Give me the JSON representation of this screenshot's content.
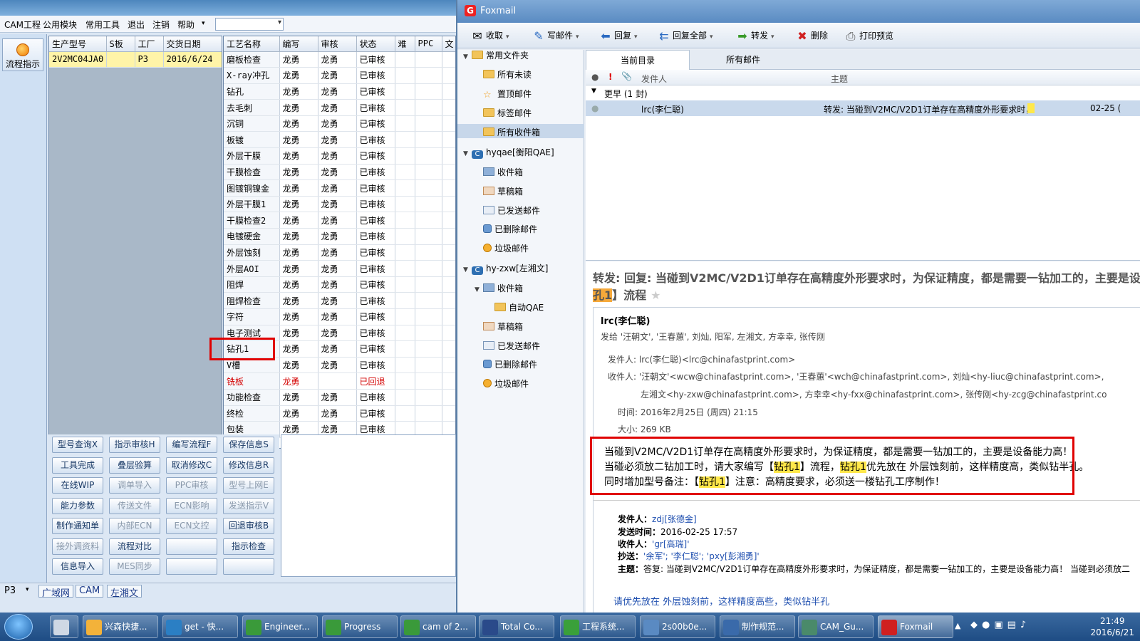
{
  "cam": {
    "menu": [
      "CAM工程",
      "公用模块",
      "常用工具",
      "退出",
      "注销",
      "帮助"
    ],
    "flow_button": "流程指示",
    "grid1": {
      "headers": [
        "生产型号",
        "S板",
        "工厂",
        "交货日期"
      ],
      "row": [
        "2V2MC04JA0",
        "",
        "P3",
        "2016/6/24"
      ]
    },
    "grid2": {
      "headers": [
        "工艺名称",
        "编写",
        "审核",
        "状态",
        "难",
        "PPC",
        "文"
      ],
      "rows": [
        [
          "磨板检查",
          "龙勇",
          "龙勇",
          "已审核"
        ],
        [
          "X-ray冲孔",
          "龙勇",
          "龙勇",
          "已审核"
        ],
        [
          "钻孔",
          "龙勇",
          "龙勇",
          "已审核"
        ],
        [
          "去毛刺",
          "龙勇",
          "龙勇",
          "已审核"
        ],
        [
          "沉铜",
          "龙勇",
          "龙勇",
          "已审核"
        ],
        [
          "板镀",
          "龙勇",
          "龙勇",
          "已审核"
        ],
        [
          "外层干膜",
          "龙勇",
          "龙勇",
          "已审核"
        ],
        [
          "干膜检查",
          "龙勇",
          "龙勇",
          "已审核"
        ],
        [
          "图镀铜镍金",
          "龙勇",
          "龙勇",
          "已审核"
        ],
        [
          "外层干膜1",
          "龙勇",
          "龙勇",
          "已审核"
        ],
        [
          "干膜检查2",
          "龙勇",
          "龙勇",
          "已审核"
        ],
        [
          "电镀硬金",
          "龙勇",
          "龙勇",
          "已审核"
        ],
        [
          "外层蚀刻",
          "龙勇",
          "龙勇",
          "已审核"
        ],
        [
          "外层AOI",
          "龙勇",
          "龙勇",
          "已审核"
        ],
        [
          "阻焊",
          "龙勇",
          "龙勇",
          "已审核"
        ],
        [
          "阻焊检查",
          "龙勇",
          "龙勇",
          "已审核"
        ],
        [
          "字符",
          "龙勇",
          "龙勇",
          "已审核"
        ],
        [
          "电子测试",
          "龙勇",
          "龙勇",
          "已审核"
        ],
        [
          "钻孔1",
          "龙勇",
          "龙勇",
          "已审核"
        ],
        [
          "V槽",
          "龙勇",
          "龙勇",
          "已审核"
        ],
        [
          "铣板",
          "龙勇",
          "",
          "已回退"
        ],
        [
          "功能检查",
          "龙勇",
          "龙勇",
          "已审核"
        ],
        [
          "终检",
          "龙勇",
          "龙勇",
          "已审核"
        ],
        [
          "包装",
          "龙勇",
          "龙勇",
          "已审核"
        ]
      ]
    },
    "buttons": [
      [
        "型号查询X",
        "指示审核H",
        "编写流程F",
        "保存信息S"
      ],
      [
        "工具完成",
        "叠层验算",
        "取消修改C",
        "修改信息R"
      ],
      [
        "在线WIP",
        "调单导入",
        "PPC审核",
        "型号上网E"
      ],
      [
        "能力参数",
        "传送文件",
        "ECN影响",
        "发送指示V"
      ],
      [
        "制作通知单",
        "内部ECN",
        "ECN文控",
        "回退审核B"
      ],
      [
        "接外调资料",
        "流程对比",
        "",
        "指示检查"
      ],
      [
        "信息导入",
        "MES同步",
        "",
        ""
      ]
    ],
    "status": {
      "combo": "P3",
      "tabs": [
        "广域网",
        "CAM",
        "左湘文"
      ]
    }
  },
  "foxmail": {
    "title": "Foxmail",
    "toolbar": [
      "收取",
      "写邮件",
      "回复",
      "回复全部",
      "转发",
      "删除",
      "打印预览"
    ],
    "tree": [
      {
        "label": "常用文件夹",
        "level": 0,
        "type": "folder"
      },
      {
        "label": "所有未读",
        "level": 1,
        "type": "folder"
      },
      {
        "label": "置顶邮件",
        "level": 1,
        "type": "star"
      },
      {
        "label": "标签邮件",
        "level": 1,
        "type": "folder"
      },
      {
        "label": "所有收件箱",
        "level": 1,
        "type": "folder"
      },
      {
        "label": "hyqae[衡阳QAE]",
        "level": 0,
        "type": "acct"
      },
      {
        "label": "收件箱",
        "level": 1,
        "type": "inbox"
      },
      {
        "label": "草稿箱",
        "level": 1,
        "type": "draft"
      },
      {
        "label": "已发送邮件",
        "level": 1,
        "type": "sent"
      },
      {
        "label": "已删除邮件",
        "level": 1,
        "type": "trash"
      },
      {
        "label": "垃圾邮件",
        "level": 1,
        "type": "junk"
      },
      {
        "label": "hy-zxw[左湘文]",
        "level": 0,
        "type": "acct"
      },
      {
        "label": "收件箱",
        "level": 1,
        "type": "inbox"
      },
      {
        "label": "自动QAE",
        "level": 2,
        "type": "folder"
      },
      {
        "label": "草稿箱",
        "level": 1,
        "type": "draft"
      },
      {
        "label": "已发送邮件",
        "level": 1,
        "type": "sent"
      },
      {
        "label": "已删除邮件",
        "level": 1,
        "type": "trash"
      },
      {
        "label": "垃圾邮件",
        "level": 1,
        "type": "junk"
      }
    ],
    "tabs": [
      "当前目录",
      "所有邮件"
    ],
    "list": {
      "col_sender": "发件人",
      "col_subject": "主题",
      "group": "更早 (1 封)",
      "row_sender": "lrc(李仁聪)",
      "row_subject": "转发: 当碰到V2MC/V2D1订单存在高精度外形要求时，",
      "row_date": "02-25 ("
    },
    "read": {
      "subject_line1": "转发: 回复: 当碰到V2MC/V2D1订单存在高精度外形要求时，为保证精度，都是需要一钻加工的，主要是设",
      "subject_hl": "孔1",
      "subject_line2": "】流程",
      "sender_name": "lrc(李仁聪)",
      "sent_to": "发给 '汪朝文', '王春蕙', 刘灿, 阳军, 左湘文, 方幸幸, 张传刚",
      "from": "发件人: lrc(李仁聪)<lrc@chinafastprint.com>",
      "to_1": "收件人: '汪朝文'<wcw@chinafastprint.com>, '王春蕙'<wch@chinafastprint.com>, 刘灿<hy-liuc@chinafastprint.com>,",
      "to_2": "左湘文<hy-zxw@chinafastprint.com>, 方幸幸<hy-fxx@chinafastprint.com>, 张传刚<hy-zcg@chinafastprint.co",
      "time": "时间: 2016年2月25日 (周四) 21:15",
      "size": "大小: 269 KB",
      "body_1": "当碰到V2MC/V2D1订单存在高精度外形要求时，为保证精度，都是需要一钻加工的，主要是设备能力高！",
      "body_2a": "当碰必须放二钻加工时，请大家编写【",
      "body_2b": "钻孔1",
      "body_2c": "】流程，",
      "body_2d": "钻孔1",
      "body_2e": "优先放在 外层蚀刻前，这样精度高，类似钻半孔。",
      "body_3a": "同时增加型号备注：【",
      "body_3b": "钻孔1",
      "body_3c": "】注意：高精度要求，必须送一楼钻孔工序制作！",
      "q_from_l": "发件人：",
      "q_from": "zdj[张德金]",
      "q_time_l": "发送时间：",
      "q_time": "2016-02-25 17:57",
      "q_to_l": "收件人：",
      "q_to": "'gr[高瑞]'",
      "q_cc_l": "抄送：",
      "q_cc": "'余军'; '李仁聪'; 'pxy[彭湘勇]'",
      "q_subj_l": "主题：",
      "q_subj": "答复: 当碰到V2MC/V2D1订单存在高精度外形要求时，为保证精度，都是需要一钻加工的，主要是设备能力高！ 当碰到必须放二",
      "trailing": "请优先放在 外层蚀刻前，这样精度高些，类似钻半孔"
    }
  },
  "taskbar": {
    "items": [
      "兴森快捷...",
      "get - 快...",
      "Engineer...",
      "Progress",
      "cam of 2...",
      "Total Co...",
      "工程系统...",
      "2s00b0e...",
      "制作规范...",
      "CAM_Gu...",
      "Foxmail"
    ],
    "time": "21:49",
    "date": "2016/6/21"
  }
}
